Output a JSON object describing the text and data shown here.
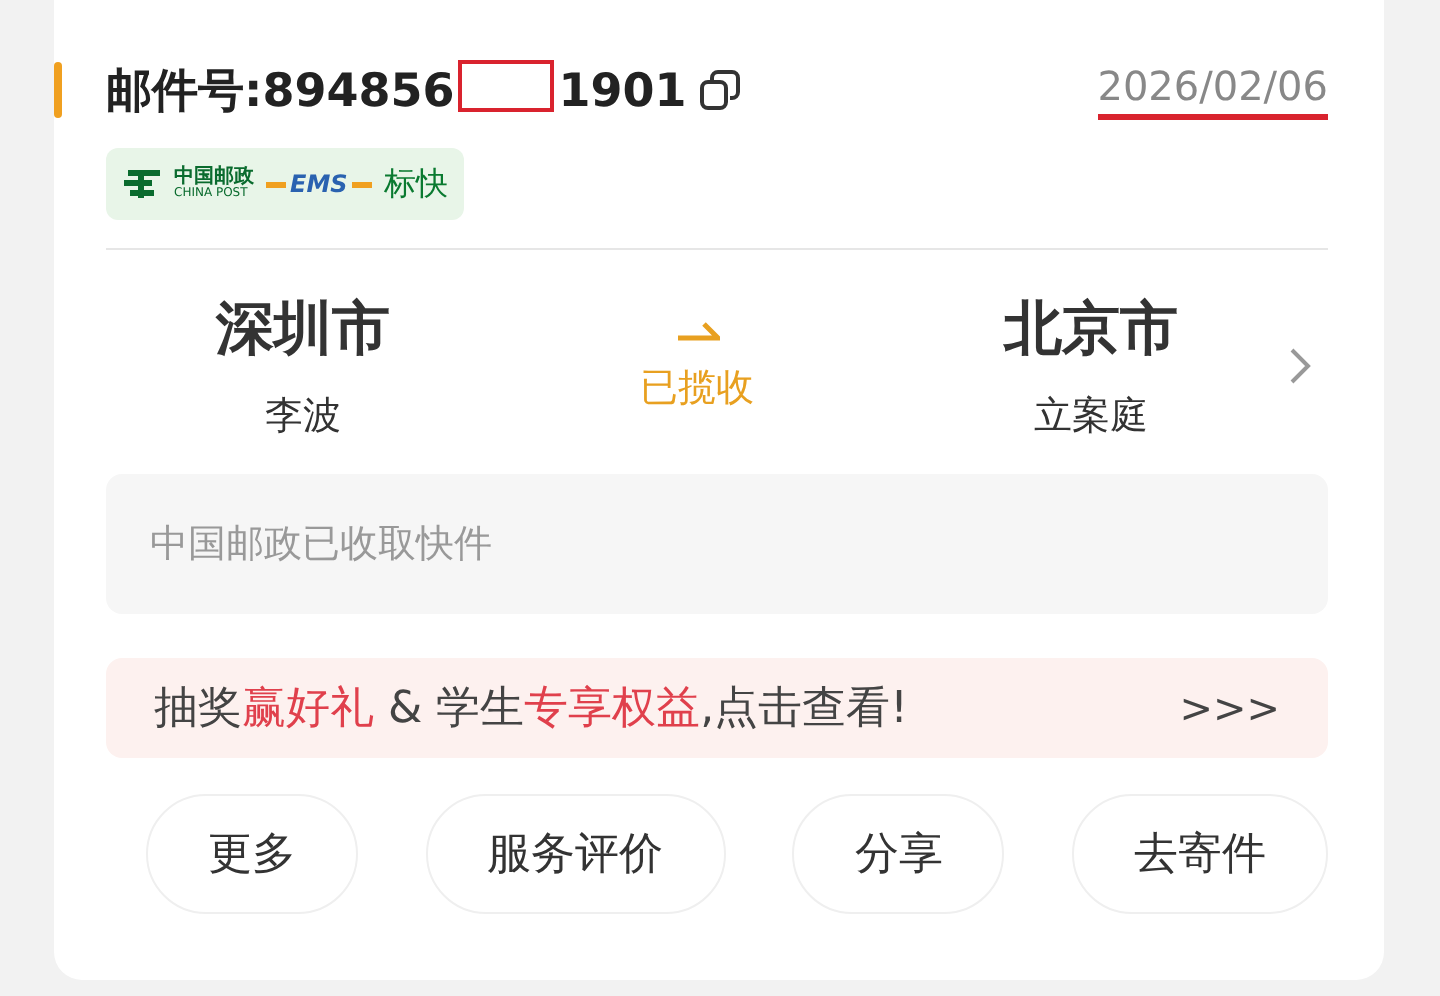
{
  "header": {
    "label": "邮件号:",
    "number_start": "894856",
    "number_end": "1901",
    "redacted": true,
    "date": "2026/02/06",
    "date_underlined": true
  },
  "service_badge": {
    "logo_cn": "中国邮政",
    "logo_en": "CHINA POST",
    "ems": "EMS",
    "product": "标快"
  },
  "route": {
    "from_city": "深圳市",
    "from_name": "李波",
    "status": "已揽收",
    "to_city": "北京市",
    "to_name": "立案庭"
  },
  "latest_event": "中国邮政已收取快件",
  "promo": {
    "segments": [
      {
        "text": "抽奖",
        "highlight": false
      },
      {
        "text": "赢好礼",
        "highlight": true
      },
      {
        "text": " & 学生",
        "highlight": false
      },
      {
        "text": "专享权益",
        "highlight": true
      },
      {
        "text": ",点击查看!",
        "highlight": false
      }
    ],
    "more": ">>>"
  },
  "actions": [
    "更多",
    "服务评价",
    "分享",
    "去寄件"
  ]
}
